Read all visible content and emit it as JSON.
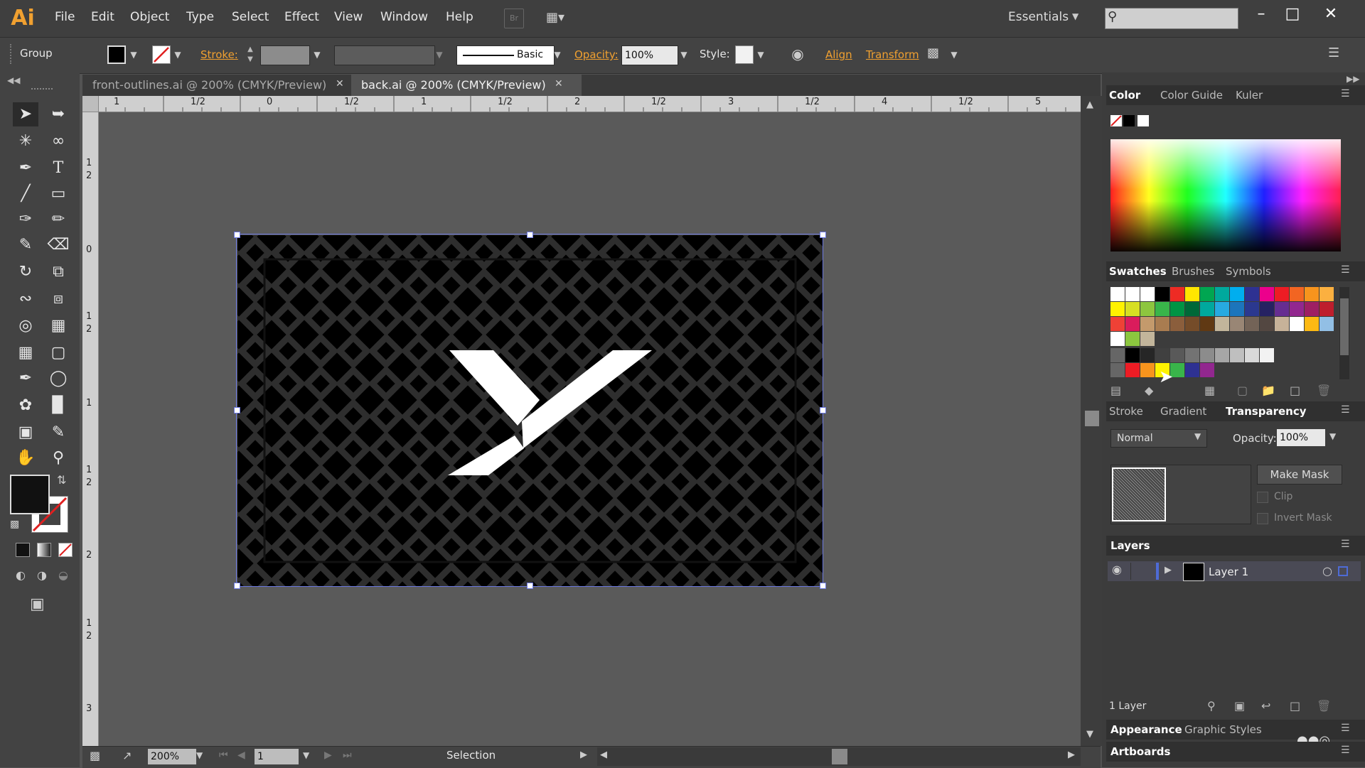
{
  "menubar": {
    "logo": "Ai",
    "items": [
      "File",
      "Edit",
      "Object",
      "Type",
      "Select",
      "Effect",
      "View",
      "Window",
      "Help"
    ],
    "bridge": "Br",
    "workspace": "Essentials"
  },
  "controlbar": {
    "selection_type": "Group",
    "stroke_label": "Stroke:",
    "stroke_profile": "Basic",
    "opacity_label": "Opacity:",
    "opacity_value": "100%",
    "style_label": "Style:",
    "align_label": "Align",
    "transform_label": "Transform"
  },
  "tabs": [
    {
      "label": "front-outlines.ai @ 200% (CMYK/Preview)",
      "active": false
    },
    {
      "label": "back.ai @ 200% (CMYK/Preview)",
      "active": true
    }
  ],
  "rulers": {
    "h_labels": [
      "1",
      "1/2",
      "0",
      "1/2",
      "1",
      "1/2",
      "2",
      "1/2",
      "3",
      "1/2",
      "4",
      "1/2",
      "5"
    ],
    "v_labels": [
      "1",
      "2",
      "0",
      "1",
      "2",
      "1",
      "1",
      "2",
      "2",
      "1",
      "2",
      "3"
    ]
  },
  "status": {
    "zoom": "200%",
    "artboard": "1",
    "tool": "Selection"
  },
  "panels": {
    "color_tabs": [
      "Color",
      "Color Guide",
      "Kuler"
    ],
    "swatch_tabs": [
      "Swatches",
      "Brushes",
      "Symbols"
    ],
    "transparency_tabs": [
      "Stroke",
      "Gradient",
      "Transparency"
    ],
    "blend_mode": "Normal",
    "opacity_label": "Opacity:",
    "opacity_value": "100%",
    "make_mask": "Make Mask",
    "clip": "Clip",
    "invert_mask": "Invert Mask",
    "layers_title": "Layers",
    "layer_name": "Layer 1",
    "layers_count": "1 Layer",
    "appearance_tabs": [
      "Appearance",
      "Graphic Styles"
    ],
    "artboards_title": "Artboards"
  },
  "colors": {
    "accent_orange": "#f0a030",
    "selection_blue": "#6b78e0",
    "panel_bg": "#3c3c3c"
  }
}
